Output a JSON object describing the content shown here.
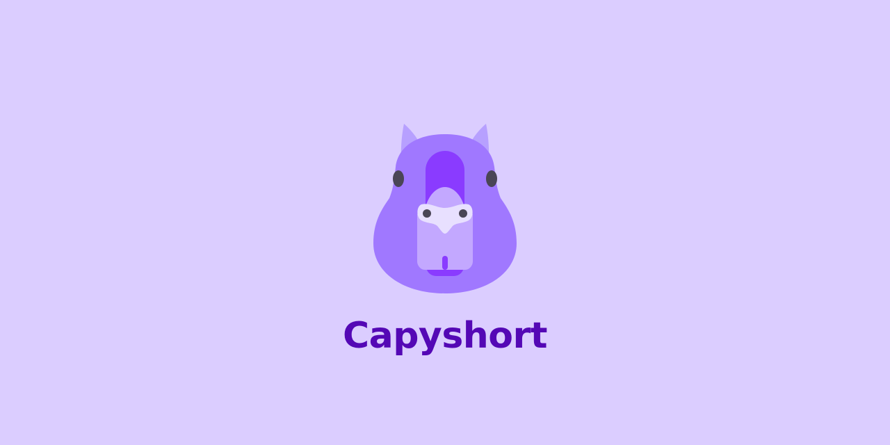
{
  "brand": {
    "name": "Capyshort",
    "logo_icon": "capybara-head-icon"
  },
  "colors": {
    "background": "#DBCDFF",
    "text": "#5408B5",
    "ear": "#B7A0FF",
    "head": "#A078FF",
    "forehead_stripe": "#8A3BFF",
    "snout": "#C3A8FF",
    "nose": "#E8E0FF",
    "eyes": "#4A4556",
    "mouth": "#8A3BFF"
  }
}
